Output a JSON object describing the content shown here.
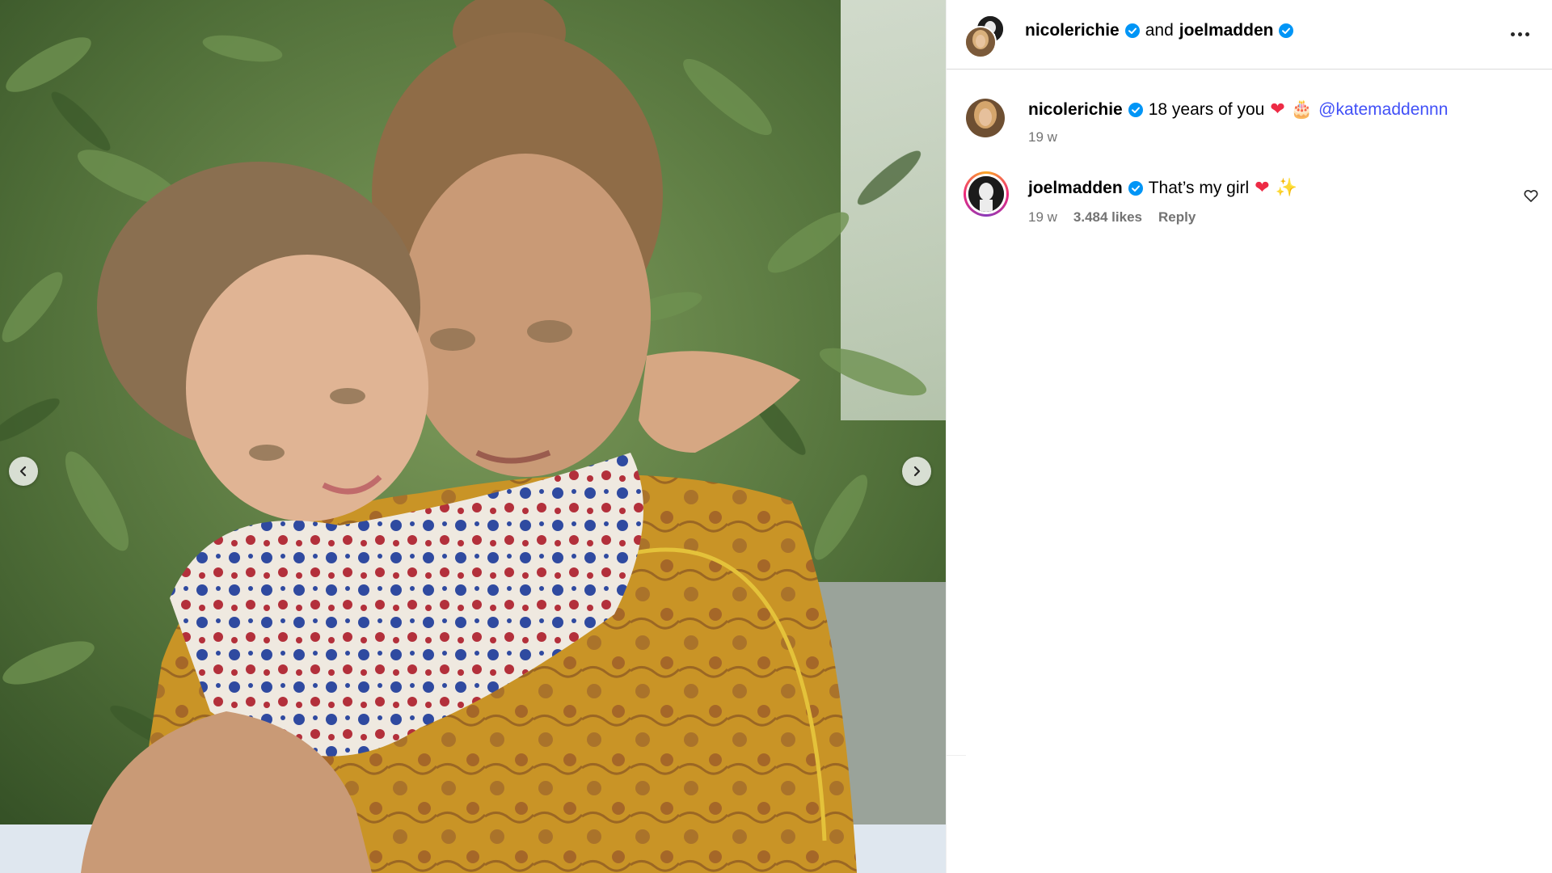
{
  "post": {
    "image_alt": "Woman in a yellow patterned dress hugging a young girl in a floral top in front of green leaves",
    "media_nav": {
      "prev_icon": "chevron-left-icon",
      "next_icon": "chevron-right-icon"
    }
  },
  "header": {
    "author": "nicolerichie",
    "joiner": "and",
    "collaborator": "joelmadden",
    "more_icon": "more-horizontal-icon"
  },
  "caption": {
    "username": "nicolerichie",
    "text": "18 years of you",
    "emojis": [
      "❤",
      "🎂"
    ],
    "mention": "@katemaddennn",
    "time": "19 w"
  },
  "comments": [
    {
      "username": "joelmadden",
      "text": "That’s my girl",
      "emojis": [
        "❤",
        "✨"
      ],
      "time": "19 w",
      "likes": "3.484 likes",
      "reply_label": "Reply"
    }
  ],
  "colors": {
    "mention": "#4150f7",
    "verified": "#0095f6",
    "meta": "#737373",
    "divider": "#dbdbdb"
  }
}
